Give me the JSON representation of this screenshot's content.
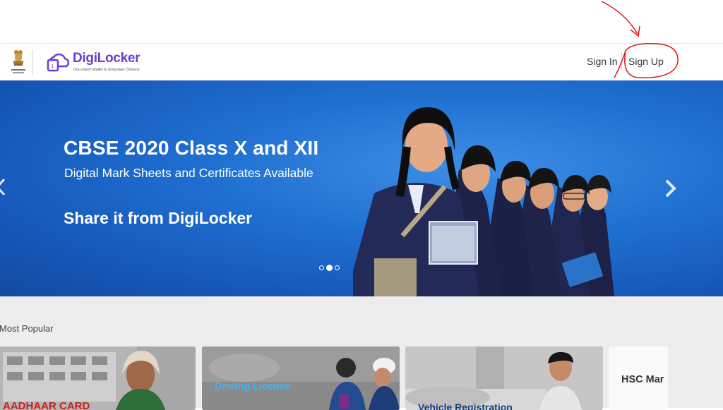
{
  "header": {
    "logo_title": "DigiLocker",
    "logo_tagline": "Document Wallet to Empower Citizens",
    "signin_label": "Sign In",
    "signup_label": "Sign Up"
  },
  "hero": {
    "title": "CBSE 2020 Class X and XII",
    "subtitle": "Digital Mark Sheets and Certificates Available",
    "share_text": "Share it from DigiLocker",
    "carousel": {
      "slide_count": 3,
      "active_slide": 2
    }
  },
  "popular": {
    "title": "Most Popular",
    "cards": [
      {
        "label": "AADHAAR CARD"
      },
      {
        "label": "Driving Licence"
      },
      {
        "label": "Vehicle Registration"
      },
      {
        "label": "HSC Mar"
      }
    ]
  },
  "colors": {
    "brand_purple": "#6a3fcf",
    "hero_blue": "#1f6fd1",
    "annotation_red": "#e0141c"
  },
  "icons": [
    "national-emblem-icon",
    "digilocker-logo-icon",
    "chevron-left-icon",
    "chevron-right-icon"
  ]
}
